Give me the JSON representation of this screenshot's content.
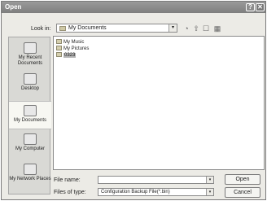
{
  "window": {
    "title": "Open",
    "help_glyph": "?",
    "close_glyph": "✕"
  },
  "lookin": {
    "label": "Look in:",
    "value": "My Documents",
    "arrow": "▾"
  },
  "toolbar": {
    "back_glyph": "◔",
    "up_glyph": "⇧",
    "newfolder_glyph": "☐",
    "views_glyph": "▦"
  },
  "places": [
    {
      "label": "My Recent Documents",
      "icon": "recent-documents-icon"
    },
    {
      "label": "Desktop",
      "icon": "desktop-icon"
    },
    {
      "label": "My Documents",
      "icon": "my-documents-icon"
    },
    {
      "label": "My Computer",
      "icon": "my-computer-icon"
    },
    {
      "label": "My Network Places",
      "icon": "network-places-icon"
    }
  ],
  "files": [
    {
      "name": "My Music",
      "icon": "folder-icon"
    },
    {
      "name": "My Pictures",
      "icon": "folder-icon"
    },
    {
      "name": "0323",
      "icon": "folder-icon"
    }
  ],
  "filename": {
    "label": "File name:",
    "value": ""
  },
  "filetype": {
    "label": "Files of type:",
    "value": "Configuration Backup File(*.bin)"
  },
  "buttons": {
    "open": "Open",
    "cancel": "Cancel"
  },
  "colors": {
    "titlebar": "#8a8a8a",
    "dialog_bg": "#ecebe6"
  }
}
